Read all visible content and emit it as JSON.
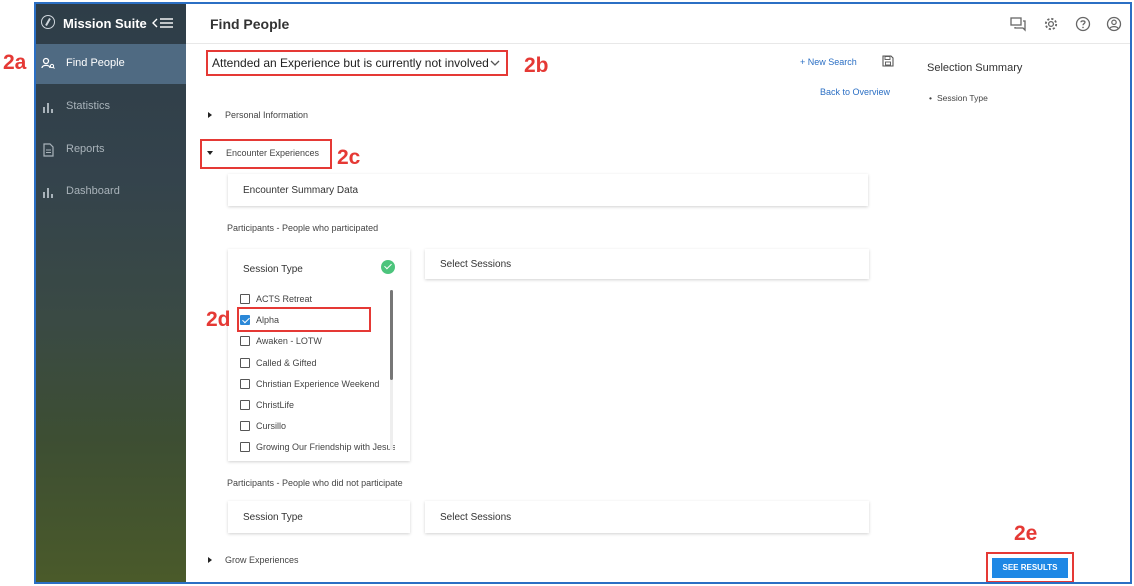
{
  "app": {
    "brand": "Mission Suite",
    "page_title": "Find People"
  },
  "sidebar": {
    "items": [
      {
        "label": "Find People",
        "icon": "person-search-icon",
        "active": true
      },
      {
        "label": "Statistics",
        "icon": "bar-chart-icon",
        "active": false
      },
      {
        "label": "Reports",
        "icon": "document-icon",
        "active": false
      },
      {
        "label": "Dashboard",
        "icon": "bar-chart-icon",
        "active": false
      }
    ]
  },
  "topbar_icons": [
    "chat-icon",
    "gear-icon",
    "help-icon",
    "account-icon"
  ],
  "search": {
    "selected": "Attended an Experience but is currently not involved",
    "new_search": "+ New Search",
    "back_link": "Back to Overview"
  },
  "sections": {
    "personal": "Personal Information",
    "encounter": "Encounter Experiences",
    "grow": "Grow Experiences"
  },
  "encounter": {
    "summary_card": "Encounter Summary Data",
    "participants_label": "Participants - People who participated",
    "session_type_label": "Session Type",
    "select_sessions": "Select Sessions",
    "session_types": [
      {
        "label": "ACTS Retreat",
        "checked": false
      },
      {
        "label": "Alpha",
        "checked": true
      },
      {
        "label": "Awaken - LOTW",
        "checked": false
      },
      {
        "label": "Called & Gifted",
        "checked": false
      },
      {
        "label": "Christian Experience Weekend",
        "checked": false
      },
      {
        "label": "ChristLife",
        "checked": false
      },
      {
        "label": "Cursillo",
        "checked": false
      },
      {
        "label": "Growing Our Friendship with Jesus",
        "checked": false
      }
    ],
    "non_participants_label": "Participants - People who did not participate",
    "session_type_label_2": "Session Type",
    "select_sessions_2": "Select Sessions"
  },
  "summary": {
    "title": "Selection Summary",
    "items": [
      "Session Type"
    ]
  },
  "actions": {
    "see_results": "SEE RESULTS"
  },
  "callouts": {
    "a": "2a",
    "b": "2b",
    "c": "2c",
    "d": "2d",
    "e": "2e"
  },
  "colors": {
    "accent": "#1e88e5",
    "highlight": "#e53935",
    "sidebar_active": "#4f6a82",
    "success": "#4cc47c"
  }
}
